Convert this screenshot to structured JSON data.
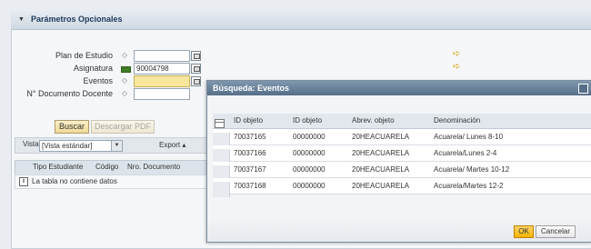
{
  "panel": {
    "title": "Parámetros Opcionales"
  },
  "form": {
    "plan_label": "Plan de Estudio",
    "asignatura_label": "Asignatura",
    "asignatura_value": "90004798",
    "eventos_label": "Eventos",
    "doc_label": "N° Documento Docente"
  },
  "buttons": {
    "buscar": "Buscar",
    "descargar": "Descargar PDF"
  },
  "toolbar": {
    "vista_label": "Vista",
    "vista_value": "[Vista estándar]",
    "export_label": "Export ▴"
  },
  "table": {
    "headers": [
      "Tipo Estudiante",
      "Código",
      "Nro. Documento"
    ],
    "empty_text": "La tabla no contiene datos"
  },
  "dialog": {
    "title": "Búsqueda: Eventos",
    "columns": [
      "ID objeto",
      "ID objeto",
      "Abrev. objeto",
      "Denominación"
    ],
    "rows": [
      [
        "70037165",
        "00000000",
        "20HEACUARELA",
        "Acuarela/ Lunes 8-10"
      ],
      [
        "70037166",
        "00000000",
        "20HEACUARELA",
        "Acuarela/Lunes 2-4"
      ],
      [
        "70037167",
        "00000000",
        "20HEACUARELA",
        "Acuarela/ Martes 10-12"
      ],
      [
        "70037168",
        "00000000",
        "20HEACUARELA",
        "Acuarela/Martes 12-2"
      ]
    ],
    "ok_label": "OK",
    "cancel_label": "Cancelar"
  },
  "colors": {
    "dialog_title": "#566f88",
    "ok_button": "#f4b400",
    "required_field": "#f7e79d"
  }
}
